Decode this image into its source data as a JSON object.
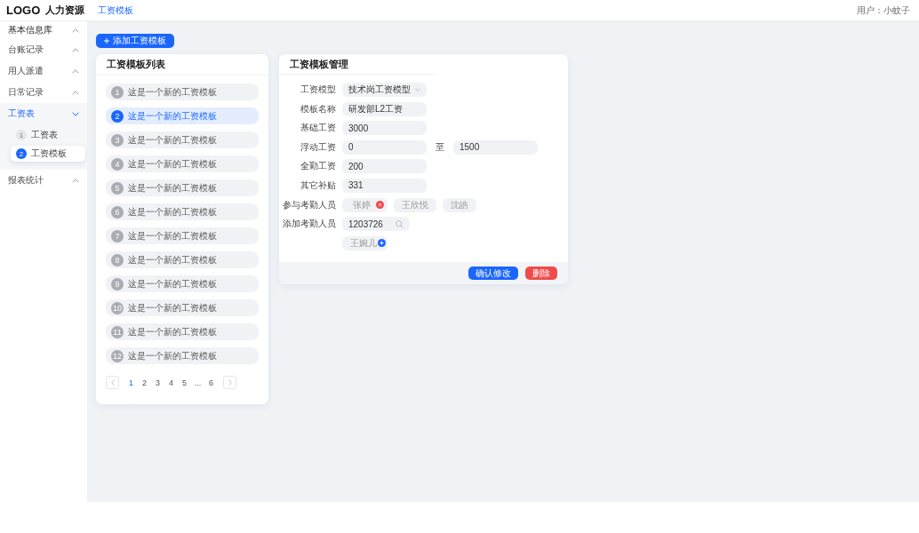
{
  "header": {
    "logo": "LOGO",
    "app_name": "人力资源",
    "breadcrumb": "工资模板",
    "user": "用户：小蚊子"
  },
  "sidebar": {
    "items": [
      {
        "label": "基本信息库",
        "expanded": false,
        "selected": false
      },
      {
        "label": "台账记录",
        "expanded": false,
        "selected": false
      },
      {
        "label": "用人派遣",
        "expanded": false,
        "selected": false
      },
      {
        "label": "日常记录",
        "expanded": false,
        "selected": false
      },
      {
        "label": "工资表",
        "expanded": true,
        "selected": true,
        "children": [
          {
            "number": "1",
            "label": "工资表",
            "selected": false
          },
          {
            "number": "2",
            "label": "工资模板",
            "selected": true
          }
        ]
      },
      {
        "label": "报表统计",
        "expanded": false,
        "selected": false
      }
    ]
  },
  "add_button": "添加工资模板",
  "template_list": {
    "title": "工资模板列表",
    "items": [
      {
        "number": "1",
        "label": "这是一个新的工资模板",
        "selected": false
      },
      {
        "number": "2",
        "label": "这是一个新的工资模板",
        "selected": true
      },
      {
        "number": "3",
        "label": "这是一个新的工资模板",
        "selected": false
      },
      {
        "number": "4",
        "label": "这是一个新的工资模板",
        "selected": false
      },
      {
        "number": "5",
        "label": "这是一个新的工资模板",
        "selected": false
      },
      {
        "number": "6",
        "label": "这是一个新的工资模板",
        "selected": false
      },
      {
        "number": "7",
        "label": "这是一个新的工资模板",
        "selected": false
      },
      {
        "number": "8",
        "label": "这是一个新的工资模板",
        "selected": false
      },
      {
        "number": "9",
        "label": "这是一个新的工资模板",
        "selected": false
      },
      {
        "number": "10",
        "label": "这是一个新的工资模板",
        "selected": false
      },
      {
        "number": "11",
        "label": "这是一个新的工资模板",
        "selected": false
      },
      {
        "number": "12",
        "label": "这是一个新的工资模板",
        "selected": false
      }
    ],
    "pagination": {
      "pages": [
        {
          "label": "1",
          "selected": true
        },
        {
          "label": "2",
          "selected": false
        },
        {
          "label": "3",
          "selected": false
        },
        {
          "label": "4",
          "selected": false
        },
        {
          "label": "5",
          "selected": false
        },
        {
          "label": "...",
          "selected": false
        },
        {
          "label": "6",
          "selected": false
        }
      ]
    }
  },
  "template_form": {
    "title": "工资模板管理",
    "fields": [
      {
        "kind": "select",
        "label": "工资模型",
        "value": "技术岗工资模型"
      },
      {
        "kind": "text",
        "label": "模板名称",
        "value": "研发部L2工资"
      },
      {
        "kind": "text",
        "label": "基础工资",
        "value": "3000"
      },
      {
        "kind": "range",
        "label": "浮动工资",
        "from": "0",
        "separator": "至",
        "to": "1500"
      },
      {
        "kind": "text",
        "label": "全勤工资",
        "value": "200"
      },
      {
        "kind": "text",
        "label": "其它补贴",
        "value": "331"
      },
      {
        "kind": "chips",
        "label": "参与考勤人员",
        "chips": [
          {
            "name": "张婷",
            "removable": true
          },
          {
            "name": "王欣悦",
            "removable": false
          },
          {
            "name": "沈皓",
            "removable": false
          }
        ]
      },
      {
        "kind": "search",
        "label": "添加考勤人员",
        "value": "1203726",
        "results": [
          {
            "name": "王婉儿"
          }
        ]
      }
    ],
    "buttons": [
      {
        "label": "确认修改",
        "kind": "primary"
      },
      {
        "label": "删除",
        "kind": "danger"
      }
    ]
  }
}
